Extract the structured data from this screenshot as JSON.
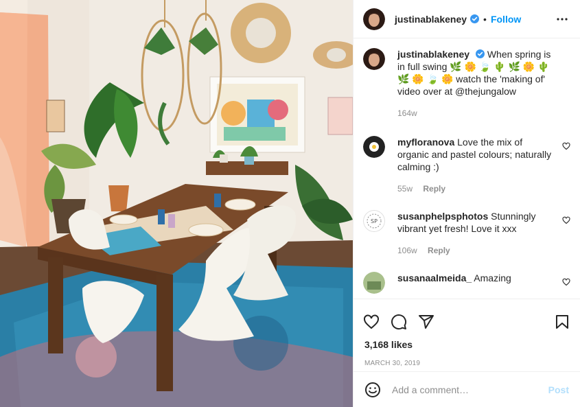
{
  "post": {
    "username": "justinablakeney",
    "follow_label": "Follow",
    "separator": "•",
    "caption": {
      "username": "justinablakeney",
      "text": "When spring is in full swing 🌿 🌼 🍃 🌵 🌿 🌼 🌵 🌿 🌼 🍃 🌼 watch the 'making of' video over at @thejungalow",
      "age": "164w"
    },
    "comments": [
      {
        "username": "myfloranova",
        "text": "Love the mix of organic and pastel colours; naturally calming :)",
        "age": "55w",
        "reply": "Reply"
      },
      {
        "username": "susanphelpsphotos",
        "text": "Stunningly vibrant yet fresh! Love it xxx",
        "age": "106w",
        "reply": "Reply"
      },
      {
        "username": "susanaalmeida_",
        "text": "Amazing"
      }
    ],
    "likes": "3,168 likes",
    "date": "MARCH 30, 2019",
    "add_comment_placeholder": "Add a comment…",
    "post_label": "Post"
  },
  "icons": {
    "verified": "verified-badge-icon",
    "more": "more-options-icon",
    "like": "heart-icon",
    "comment": "comment-icon",
    "share": "share-icon",
    "save": "bookmark-icon",
    "emoji": "emoji-icon"
  },
  "colors": {
    "accent": "#0095f6",
    "post_disabled": "#b2dffc",
    "muted": "#8e8e8e",
    "border": "#efefef"
  }
}
